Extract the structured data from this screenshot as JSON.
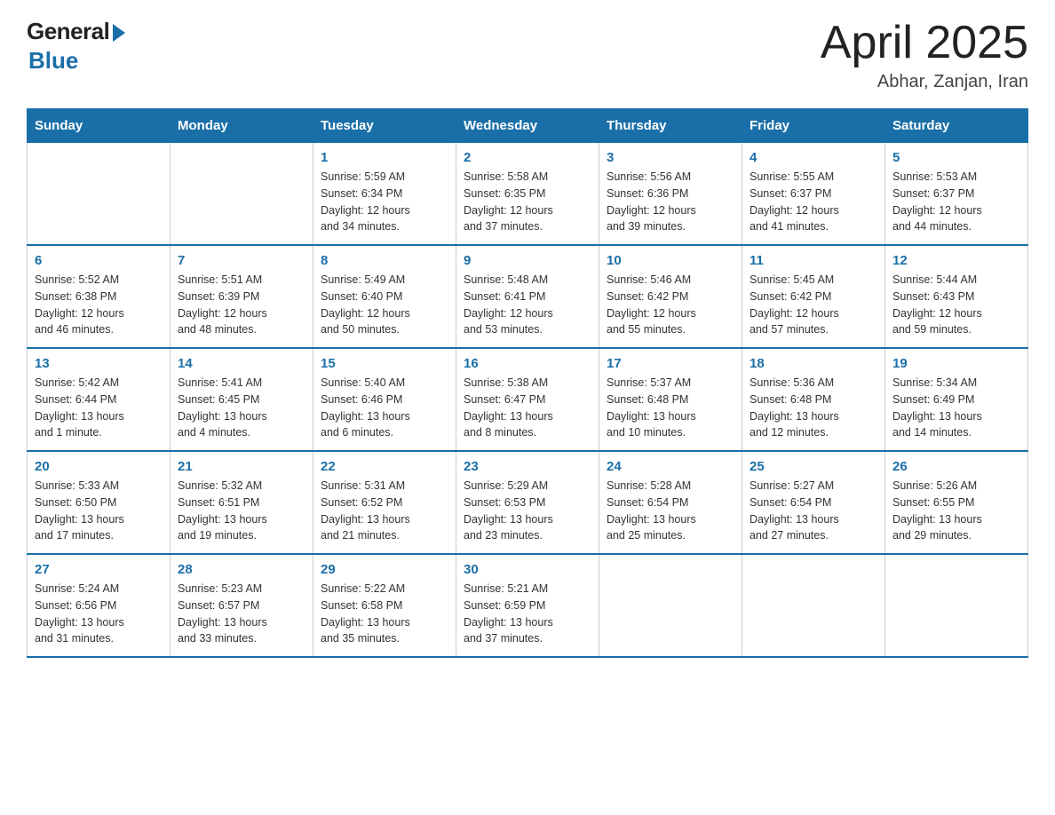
{
  "header": {
    "logo_general": "General",
    "logo_blue": "Blue",
    "title": "April 2025",
    "subtitle": "Abhar, Zanjan, Iran"
  },
  "days_of_week": [
    "Sunday",
    "Monday",
    "Tuesday",
    "Wednesday",
    "Thursday",
    "Friday",
    "Saturday"
  ],
  "weeks": [
    [
      {
        "num": "",
        "info": ""
      },
      {
        "num": "",
        "info": ""
      },
      {
        "num": "1",
        "info": "Sunrise: 5:59 AM\nSunset: 6:34 PM\nDaylight: 12 hours\nand 34 minutes."
      },
      {
        "num": "2",
        "info": "Sunrise: 5:58 AM\nSunset: 6:35 PM\nDaylight: 12 hours\nand 37 minutes."
      },
      {
        "num": "3",
        "info": "Sunrise: 5:56 AM\nSunset: 6:36 PM\nDaylight: 12 hours\nand 39 minutes."
      },
      {
        "num": "4",
        "info": "Sunrise: 5:55 AM\nSunset: 6:37 PM\nDaylight: 12 hours\nand 41 minutes."
      },
      {
        "num": "5",
        "info": "Sunrise: 5:53 AM\nSunset: 6:37 PM\nDaylight: 12 hours\nand 44 minutes."
      }
    ],
    [
      {
        "num": "6",
        "info": "Sunrise: 5:52 AM\nSunset: 6:38 PM\nDaylight: 12 hours\nand 46 minutes."
      },
      {
        "num": "7",
        "info": "Sunrise: 5:51 AM\nSunset: 6:39 PM\nDaylight: 12 hours\nand 48 minutes."
      },
      {
        "num": "8",
        "info": "Sunrise: 5:49 AM\nSunset: 6:40 PM\nDaylight: 12 hours\nand 50 minutes."
      },
      {
        "num": "9",
        "info": "Sunrise: 5:48 AM\nSunset: 6:41 PM\nDaylight: 12 hours\nand 53 minutes."
      },
      {
        "num": "10",
        "info": "Sunrise: 5:46 AM\nSunset: 6:42 PM\nDaylight: 12 hours\nand 55 minutes."
      },
      {
        "num": "11",
        "info": "Sunrise: 5:45 AM\nSunset: 6:42 PM\nDaylight: 12 hours\nand 57 minutes."
      },
      {
        "num": "12",
        "info": "Sunrise: 5:44 AM\nSunset: 6:43 PM\nDaylight: 12 hours\nand 59 minutes."
      }
    ],
    [
      {
        "num": "13",
        "info": "Sunrise: 5:42 AM\nSunset: 6:44 PM\nDaylight: 13 hours\nand 1 minute."
      },
      {
        "num": "14",
        "info": "Sunrise: 5:41 AM\nSunset: 6:45 PM\nDaylight: 13 hours\nand 4 minutes."
      },
      {
        "num": "15",
        "info": "Sunrise: 5:40 AM\nSunset: 6:46 PM\nDaylight: 13 hours\nand 6 minutes."
      },
      {
        "num": "16",
        "info": "Sunrise: 5:38 AM\nSunset: 6:47 PM\nDaylight: 13 hours\nand 8 minutes."
      },
      {
        "num": "17",
        "info": "Sunrise: 5:37 AM\nSunset: 6:48 PM\nDaylight: 13 hours\nand 10 minutes."
      },
      {
        "num": "18",
        "info": "Sunrise: 5:36 AM\nSunset: 6:48 PM\nDaylight: 13 hours\nand 12 minutes."
      },
      {
        "num": "19",
        "info": "Sunrise: 5:34 AM\nSunset: 6:49 PM\nDaylight: 13 hours\nand 14 minutes."
      }
    ],
    [
      {
        "num": "20",
        "info": "Sunrise: 5:33 AM\nSunset: 6:50 PM\nDaylight: 13 hours\nand 17 minutes."
      },
      {
        "num": "21",
        "info": "Sunrise: 5:32 AM\nSunset: 6:51 PM\nDaylight: 13 hours\nand 19 minutes."
      },
      {
        "num": "22",
        "info": "Sunrise: 5:31 AM\nSunset: 6:52 PM\nDaylight: 13 hours\nand 21 minutes."
      },
      {
        "num": "23",
        "info": "Sunrise: 5:29 AM\nSunset: 6:53 PM\nDaylight: 13 hours\nand 23 minutes."
      },
      {
        "num": "24",
        "info": "Sunrise: 5:28 AM\nSunset: 6:54 PM\nDaylight: 13 hours\nand 25 minutes."
      },
      {
        "num": "25",
        "info": "Sunrise: 5:27 AM\nSunset: 6:54 PM\nDaylight: 13 hours\nand 27 minutes."
      },
      {
        "num": "26",
        "info": "Sunrise: 5:26 AM\nSunset: 6:55 PM\nDaylight: 13 hours\nand 29 minutes."
      }
    ],
    [
      {
        "num": "27",
        "info": "Sunrise: 5:24 AM\nSunset: 6:56 PM\nDaylight: 13 hours\nand 31 minutes."
      },
      {
        "num": "28",
        "info": "Sunrise: 5:23 AM\nSunset: 6:57 PM\nDaylight: 13 hours\nand 33 minutes."
      },
      {
        "num": "29",
        "info": "Sunrise: 5:22 AM\nSunset: 6:58 PM\nDaylight: 13 hours\nand 35 minutes."
      },
      {
        "num": "30",
        "info": "Sunrise: 5:21 AM\nSunset: 6:59 PM\nDaylight: 13 hours\nand 37 minutes."
      },
      {
        "num": "",
        "info": ""
      },
      {
        "num": "",
        "info": ""
      },
      {
        "num": "",
        "info": ""
      }
    ]
  ]
}
